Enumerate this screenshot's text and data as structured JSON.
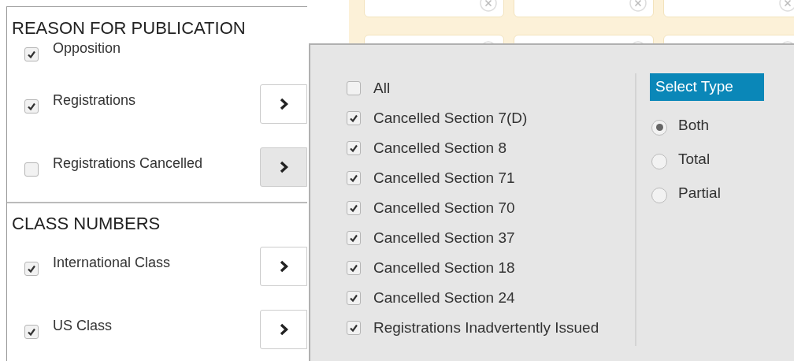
{
  "sections": [
    {
      "title": "REASON FOR PUBLICATION",
      "items": [
        {
          "label": "Opposition",
          "checked": true,
          "kind": "plain"
        },
        {
          "label": "Registrations",
          "checked": true,
          "kind": "expandable",
          "active": false
        },
        {
          "label": "Registrations Cancelled",
          "checked": false,
          "kind": "expandable",
          "active": true
        }
      ]
    },
    {
      "title": "CLASS NUMBERS",
      "items": [
        {
          "label": "International Class",
          "checked": true,
          "kind": "expandable",
          "active": false
        },
        {
          "label": "US Class",
          "checked": true,
          "kind": "expandable",
          "active": false
        }
      ]
    }
  ],
  "popover": {
    "options": [
      {
        "label": "All",
        "checked": false
      },
      {
        "label": "Cancelled Section 7(D)",
        "checked": true
      },
      {
        "label": "Cancelled Section 8",
        "checked": true
      },
      {
        "label": "Cancelled Section 71",
        "checked": true
      },
      {
        "label": "Cancelled Section 70",
        "checked": true
      },
      {
        "label": "Cancelled Section 37",
        "checked": true
      },
      {
        "label": "Cancelled Section 18",
        "checked": true
      },
      {
        "label": "Cancelled Section 24",
        "checked": true
      },
      {
        "label": "Registrations Inadvertently Issued",
        "checked": true
      }
    ],
    "type_panel": {
      "title": "Select Type",
      "options": [
        {
          "label": "Both",
          "selected": true
        },
        {
          "label": "Total",
          "selected": false
        },
        {
          "label": "Partial",
          "selected": false
        }
      ]
    }
  }
}
